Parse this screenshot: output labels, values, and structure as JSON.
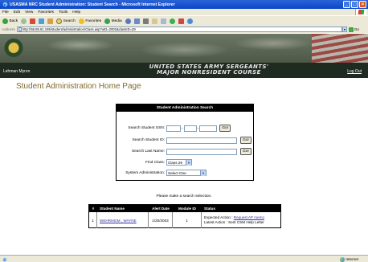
{
  "window": {
    "title": "USASMA NRC Student Administration: Student Search - Microsoft Internet Explorer"
  },
  "menubar": {
    "items": [
      "File",
      "Edit",
      "View",
      "Favorites",
      "Tools",
      "Help"
    ]
  },
  "toolbar": {
    "back": "Back",
    "search": "Search",
    "favorites": "Favorites",
    "media": "Media"
  },
  "address": {
    "label": "Address",
    "url": "http://66.85.61.195/student/administration/Class.asp?uID=2002&classID=29",
    "go": "Go"
  },
  "banner": {
    "user": "Lehman Myron",
    "headline_line1": "UNITED STATES ARMY SERGEANTS'",
    "headline_line2": "MAJOR NONRESIDENT COURSE",
    "logout": "Log Out"
  },
  "page": {
    "title": "Student Administration Home Page"
  },
  "search": {
    "header": "Student Administration Search",
    "ssn_label": "Search Student SSN:",
    "ssn_dash": "-",
    "id_label": "Search Student ID:",
    "last_label": "Search Last Name:",
    "class_label": "Find Class:",
    "class_value": "Class 29",
    "admin_label": "System Administration:",
    "admin_value": "Select One",
    "go_label": "Go!"
  },
  "message": "Please make a search selection.",
  "results": {
    "headers": [
      "#",
      "Student Name",
      "Alert Date",
      "Module ID",
      "Status"
    ],
    "rows": [
      {
        "num": "1",
        "name": "WEHRHEIM , WAYNE",
        "date": "1/20/2003",
        "module": "1",
        "status_line1_prefix": "Expected Action :",
        "status_line1_link": "Request AP memo",
        "status_line2": "Latest Action : Sent CSM Help Letter"
      }
    ]
  },
  "statusbar": {
    "zone": "Internet"
  }
}
